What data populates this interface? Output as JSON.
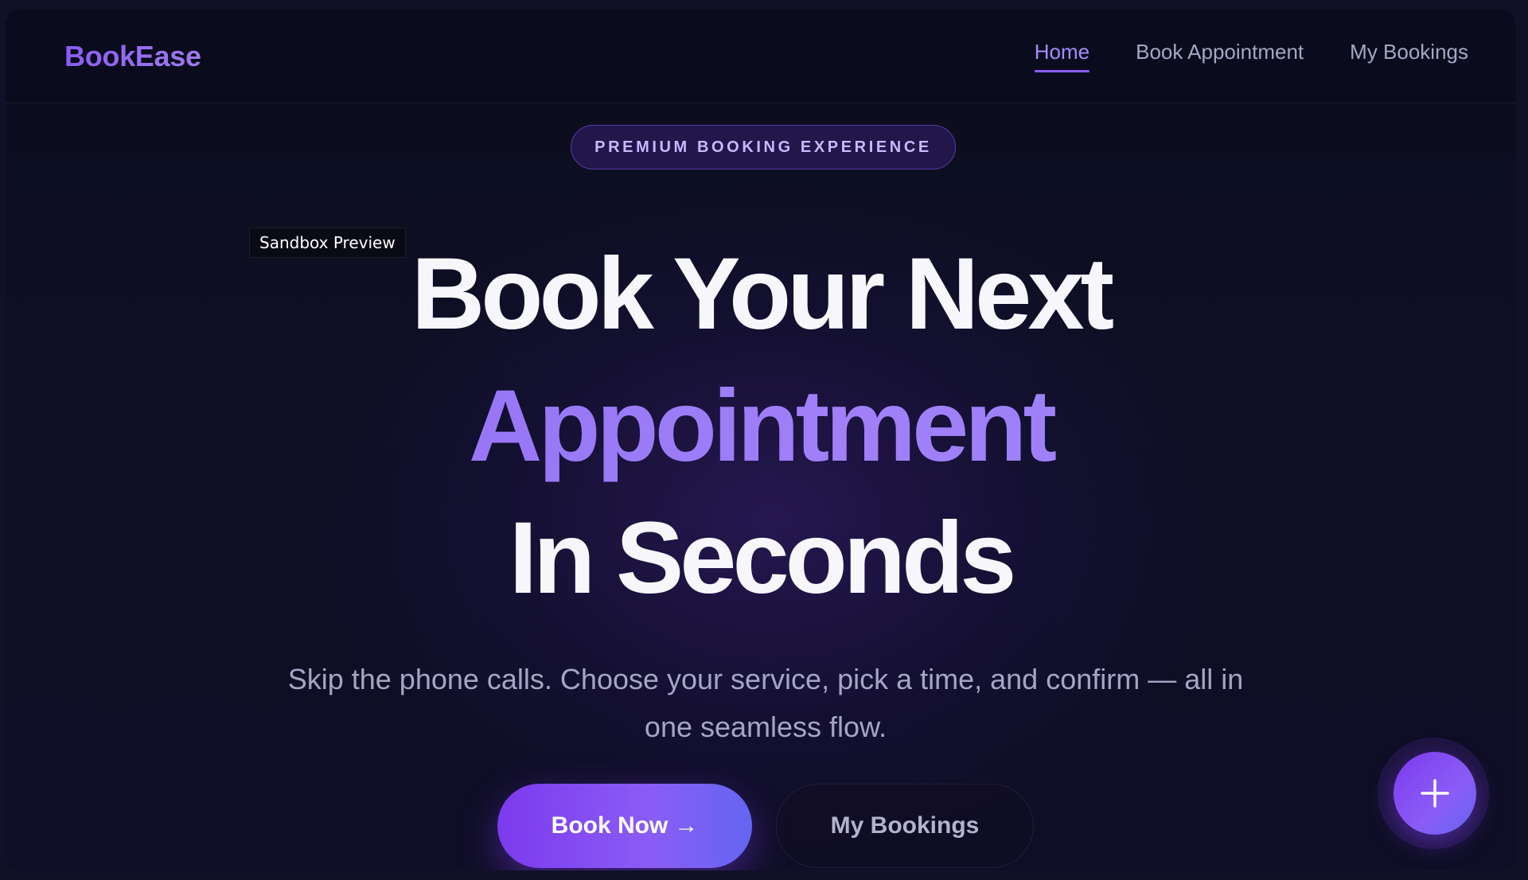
{
  "brand": {
    "name": "BookEase",
    "accent_color": "#8b5cf6"
  },
  "nav": {
    "links": [
      {
        "label": "Home",
        "active": true
      },
      {
        "label": "Book Appointment",
        "active": false
      },
      {
        "label": "My Bookings",
        "active": false
      }
    ]
  },
  "hero": {
    "badge": "PREMIUM BOOKING EXPERIENCE",
    "sandbox_label": "Sandbox Preview",
    "headline_line1": "Book Your Next",
    "headline_line2": "Appointment",
    "headline_line3": "In Seconds",
    "subtext_line1": "Skip the phone calls. Choose your service, pick a time, and confirm — all in",
    "subtext_line2": "one seamless flow.",
    "primary_cta": "Book Now",
    "primary_cta_arrow": "→",
    "secondary_cta": "My Bookings"
  },
  "fab": {
    "icon": "plus-icon"
  }
}
